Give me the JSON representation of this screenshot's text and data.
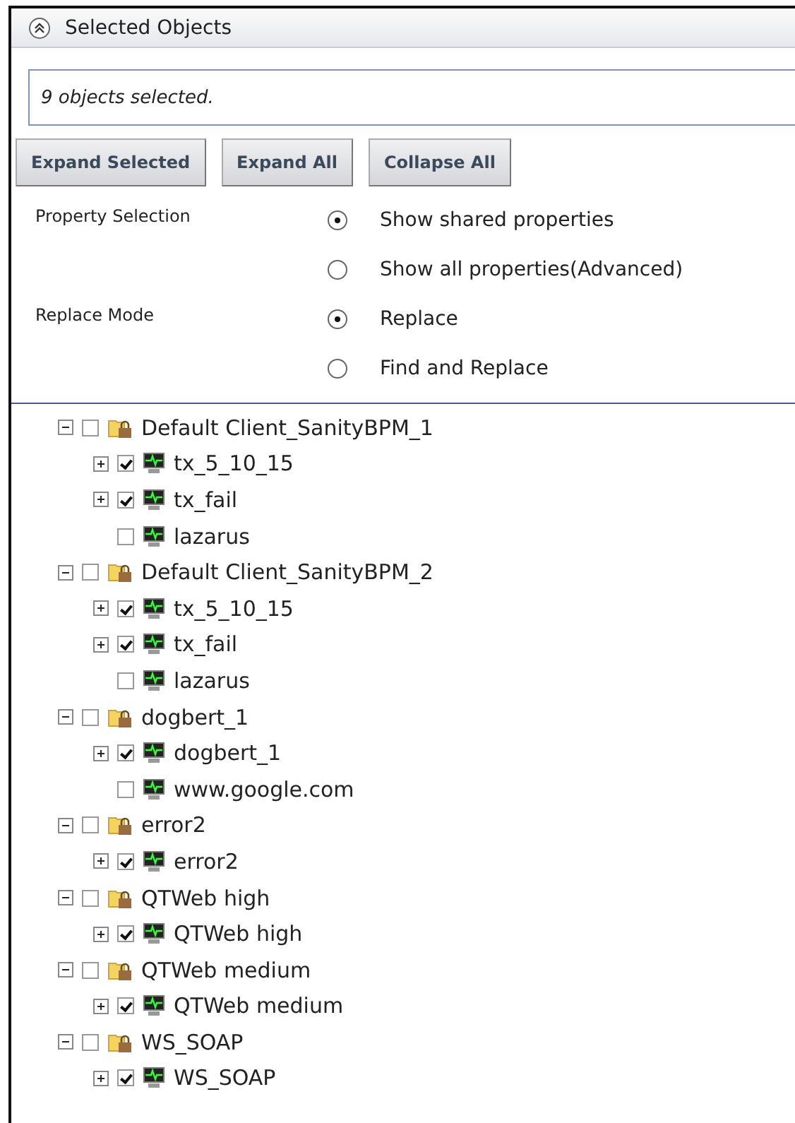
{
  "panel": {
    "title": "Selected Objects",
    "expanded": true
  },
  "status": {
    "value": "9 objects selected."
  },
  "buttons": [
    "Expand Selected",
    "Expand All",
    "Collapse All"
  ],
  "option_groups": [
    {
      "label": "Property Selection",
      "options": [
        {
          "label": "Show shared properties",
          "selected": true
        },
        {
          "label": "Show all properties(Advanced)",
          "selected": false
        }
      ]
    },
    {
      "label": "Replace Mode",
      "options": [
        {
          "label": "Replace",
          "selected": true
        },
        {
          "label": "Find and Replace",
          "selected": false
        }
      ]
    }
  ],
  "tree": [
    {
      "label": "Default Client_SanityBPM_1",
      "expanded": true,
      "checked": false,
      "children": [
        {
          "label": "tx_5_10_15",
          "kind": "branch",
          "checked": true
        },
        {
          "label": "tx_fail",
          "kind": "branch",
          "checked": true
        },
        {
          "label": "lazarus",
          "kind": "leaf",
          "checked": false
        }
      ]
    },
    {
      "label": "Default Client_SanityBPM_2",
      "expanded": true,
      "checked": false,
      "children": [
        {
          "label": "tx_5_10_15",
          "kind": "branch",
          "checked": true
        },
        {
          "label": "tx_fail",
          "kind": "branch",
          "checked": true
        },
        {
          "label": "lazarus",
          "kind": "leaf",
          "checked": false
        }
      ]
    },
    {
      "label": "dogbert_1",
      "expanded": true,
      "checked": false,
      "children": [
        {
          "label": "dogbert_1",
          "kind": "branch",
          "checked": true
        },
        {
          "label": "www.google.com",
          "kind": "leaf",
          "checked": false
        }
      ]
    },
    {
      "label": "error2",
      "expanded": true,
      "checked": false,
      "children": [
        {
          "label": "error2",
          "kind": "branch",
          "checked": true
        }
      ]
    },
    {
      "label": "QTWeb high",
      "expanded": true,
      "checked": false,
      "children": [
        {
          "label": "QTWeb high",
          "kind": "branch",
          "checked": true
        }
      ]
    },
    {
      "label": "QTWeb medium",
      "expanded": true,
      "checked": false,
      "children": [
        {
          "label": "QTWeb medium",
          "kind": "branch",
          "checked": true
        }
      ]
    },
    {
      "label": "WS_SOAP",
      "expanded": true,
      "checked": false,
      "children": [
        {
          "label": "WS_SOAP",
          "kind": "branch",
          "checked": true
        }
      ]
    }
  ]
}
